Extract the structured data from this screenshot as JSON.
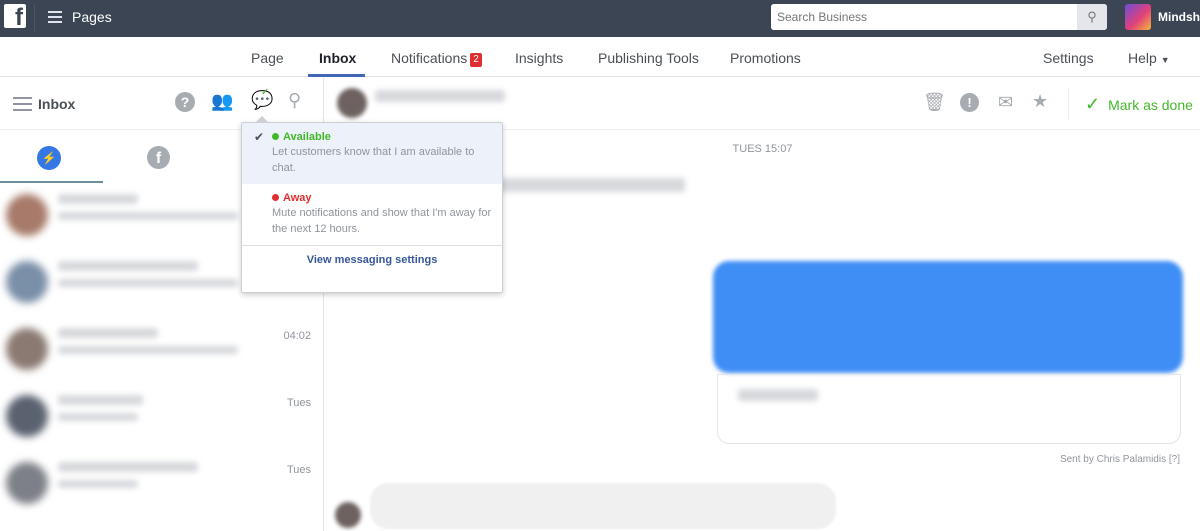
{
  "topbar": {
    "title": "Pages",
    "search_placeholder": "Search Business",
    "account": "Mindsha",
    "icons": [
      "facebook-logo",
      "menu-icon",
      "search-icon"
    ]
  },
  "nav": {
    "tabs": [
      {
        "label": "Page"
      },
      {
        "label": "Inbox",
        "active": true
      },
      {
        "label": "Notifications",
        "badge": "2"
      },
      {
        "label": "Insights"
      },
      {
        "label": "Publishing Tools"
      },
      {
        "label": "Promotions"
      }
    ],
    "settings": "Settings",
    "help": "Help"
  },
  "sidebar": {
    "title": "Inbox",
    "icons": [
      "help-icon",
      "people-icon",
      "availability-icon",
      "search-icon"
    ],
    "tabs": [
      "messenger",
      "facebook"
    ],
    "times": [
      "",
      "",
      "04:02",
      "Tues",
      "Tues"
    ]
  },
  "conversation": {
    "timestamp": "TUES 15:07",
    "mark_done": "Mark as done",
    "sent_by": "Sent by Chris Palamidis [?]",
    "accent": "#3f8ef5"
  },
  "dropdown": {
    "available": {
      "title": "Available",
      "desc": "Let customers know that I am available to chat.",
      "color": "#42b72a"
    },
    "away": {
      "title": "Away",
      "desc": "Mute notifications and show that I'm away for the next 12 hours.",
      "color": "#e02f2f"
    },
    "settings_link": "View messaging settings"
  }
}
